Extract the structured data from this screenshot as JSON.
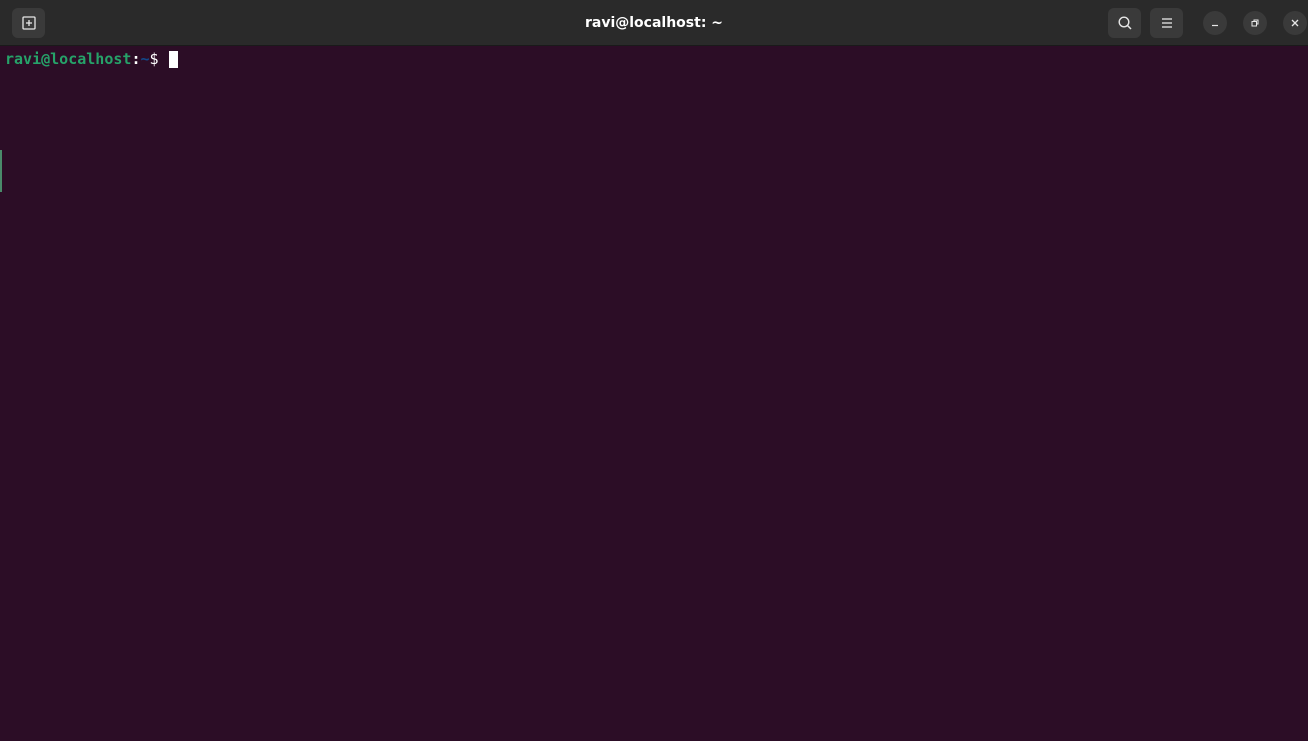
{
  "window": {
    "title": "ravi@localhost: ~"
  },
  "titlebar": {
    "new_tab_icon": "new-tab-icon",
    "search_icon": "search-icon",
    "menu_icon": "hamburger-menu-icon",
    "minimize_icon": "minimize-icon",
    "maximize_icon": "restore-icon",
    "close_icon": "close-icon"
  },
  "terminal": {
    "user_host": "ravi@localhost",
    "separator": ":",
    "path": "~",
    "prompt_symbol": "$ ",
    "input": ""
  },
  "colors": {
    "background": "#2c0d26",
    "titlebar": "#2a2a2a",
    "prompt_user": "#26a269",
    "prompt_path": "#12488b",
    "text": "#ffffff"
  }
}
